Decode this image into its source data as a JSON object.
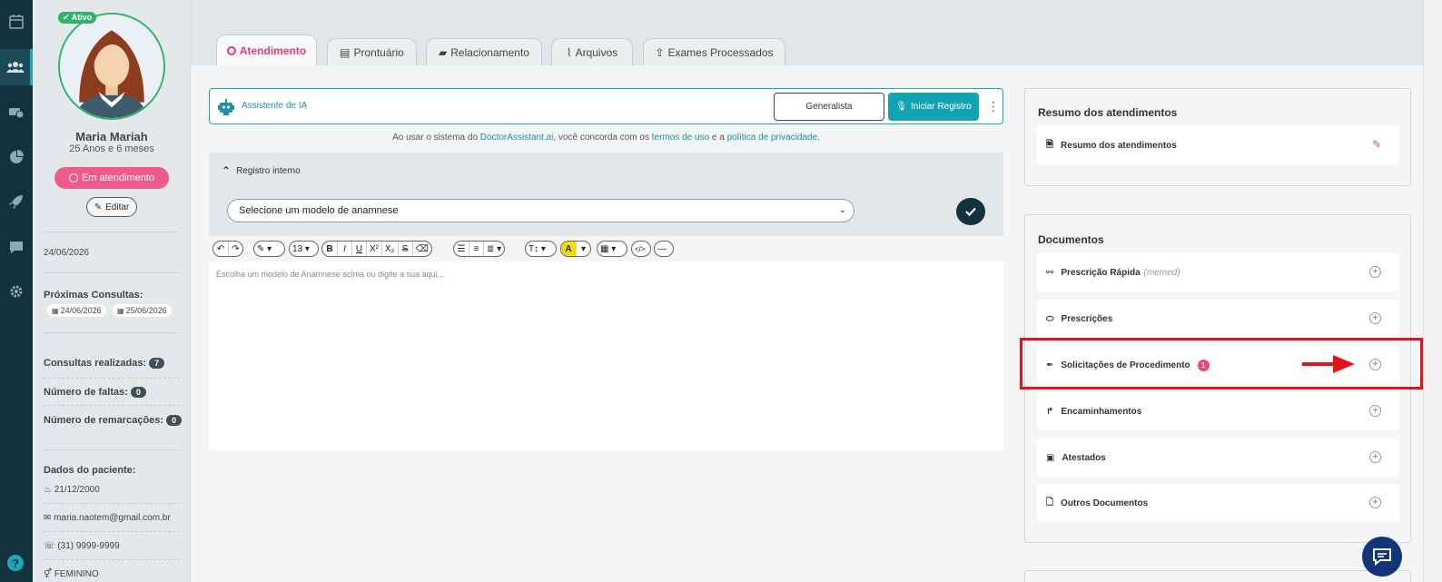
{
  "patient": {
    "status_badge": "Ativo",
    "name": "Maria Mariah",
    "age": "25 Anos e 6 meses",
    "status_button": "Em atendimento",
    "edit_button": "Editar",
    "last_date": "24/06/2026",
    "next_label": "Próximas Consultas:",
    "next_dates": [
      "24/06/2026",
      "25/06/2026"
    ],
    "stats": [
      {
        "label": "Consultas realizadas:",
        "value": "7"
      },
      {
        "label": "Número de faltas:",
        "value": "0"
      },
      {
        "label": "Número de remarcações:",
        "value": "0"
      }
    ],
    "data_title": "Dados do paciente:",
    "birth": "21/12/2000",
    "email": "maria.naotem@gmail.com.br",
    "phone": "(31) 9999-9999",
    "gender": "FEMININO"
  },
  "tabs": [
    {
      "label": "Atendimento",
      "icon": "record-icon",
      "active": true
    },
    {
      "label": "Prontuário",
      "icon": "clipboard-icon"
    },
    {
      "label": "Relacionamento",
      "icon": "message-icon"
    },
    {
      "label": "Arquivos",
      "icon": "paperclip-icon"
    },
    {
      "label": "Exames Processados",
      "icon": "upload-icon"
    }
  ],
  "ai_bar": {
    "label": "Assistente de IA",
    "generalista": "Generalista",
    "iniciar": "Iniciar Registro"
  },
  "terms": {
    "prefix": "Ao usar o sistema do ",
    "link1": "DoctorAssistant.ai",
    "mid1": ", você concorda com os ",
    "link2": "termos de uso",
    "mid2": " e a ",
    "link3": "política de privacidade",
    "suffix": "."
  },
  "registro": {
    "title": "Registro interno",
    "select_value": "Selecione um modelo de anamnese",
    "font_size": "13",
    "editor_placeholder": "Escolha um modelo de Anamnese acima ou digite a sua aqui..."
  },
  "resumo": {
    "title": "Resumo dos atendimentos",
    "row_label": "Resumo dos atendimentos"
  },
  "documentos": {
    "title": "Documentos",
    "items": [
      {
        "label": "Prescrição Rápida",
        "extra": "(memed)"
      },
      {
        "label": "Prescrições"
      },
      {
        "label": "Solicitações de Procedimento",
        "badge": "1"
      },
      {
        "label": "Encaminhamentos"
      },
      {
        "label": "Atestados"
      },
      {
        "label": "Outros Documentos"
      }
    ]
  },
  "colors": {
    "accent": "#14a3b2",
    "pink": "#ee5a8c",
    "highlight": "#e3151b",
    "nav": "#14323e"
  }
}
